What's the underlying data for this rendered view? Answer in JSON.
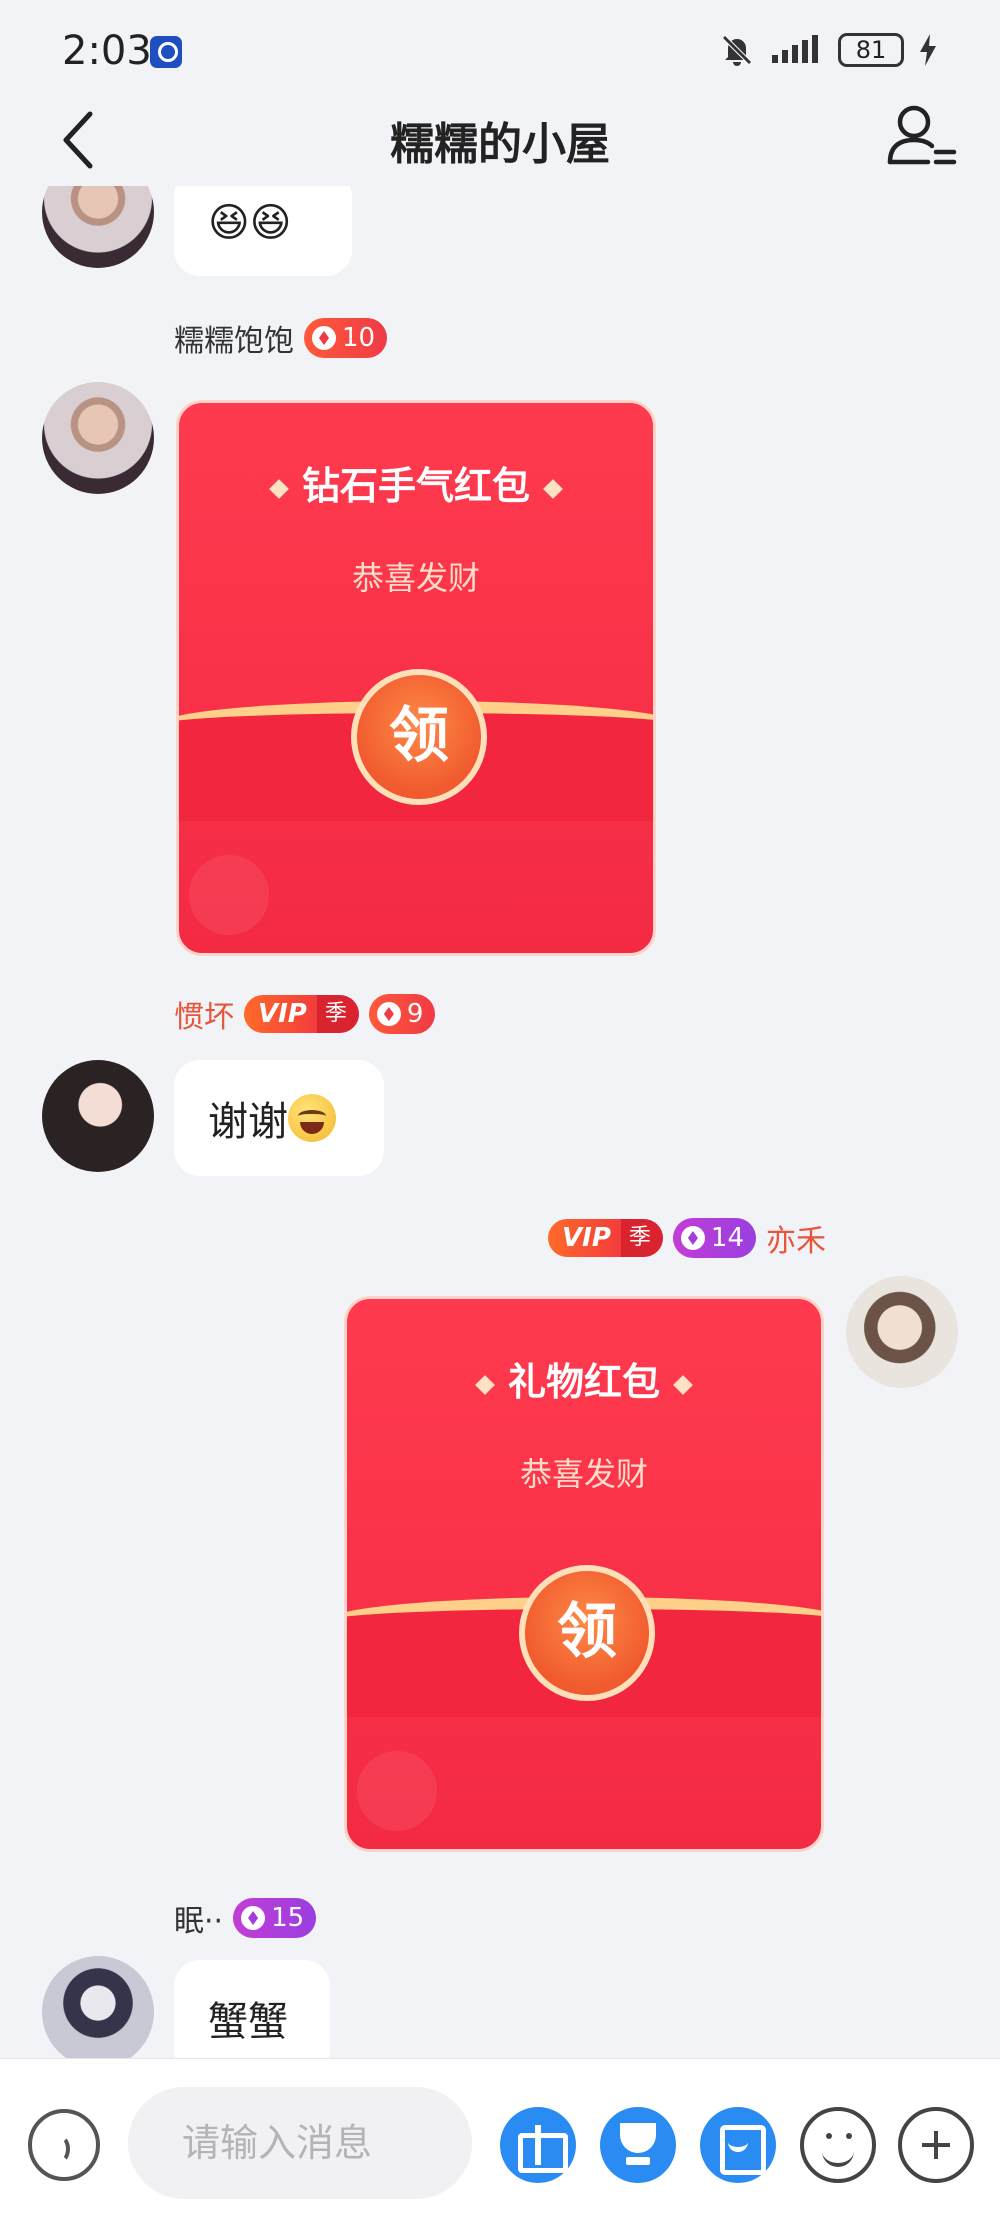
{
  "status_bar": {
    "time": "2:03",
    "battery": "81"
  },
  "header": {
    "title": "糯糯的小屋"
  },
  "messages": [
    {
      "bubble": "😆😆"
    },
    {
      "sender": "糯糯饱饱",
      "level": "10",
      "packet": {
        "title": "钻石手气红包",
        "subtitle": "恭喜发财",
        "open_label": "领"
      }
    },
    {
      "sender": "惯坏",
      "vip": "VIP",
      "vip_tag": "季",
      "level": "9",
      "bubble": "谢谢"
    },
    {
      "sender": "亦禾",
      "vip": "VIP",
      "vip_tag": "季",
      "level": "14",
      "packet": {
        "title": "礼物红包",
        "subtitle": "恭喜发财",
        "open_label": "领"
      }
    },
    {
      "sender": "眠··",
      "level": "15",
      "bubble": "蟹蟹"
    }
  ],
  "input": {
    "placeholder": "请输入消息"
  },
  "icons": [
    "back-arrow-icon",
    "user-settings-icon",
    "voice-icon",
    "gift-icon",
    "trophy-icon",
    "red-packet-icon",
    "emoji-icon",
    "plus-icon"
  ],
  "colors": {
    "packet_red": "#f42a44",
    "accent_blue": "#2a8cf2",
    "level_red": "#f03a46",
    "level_purple": "#a03fdc"
  }
}
